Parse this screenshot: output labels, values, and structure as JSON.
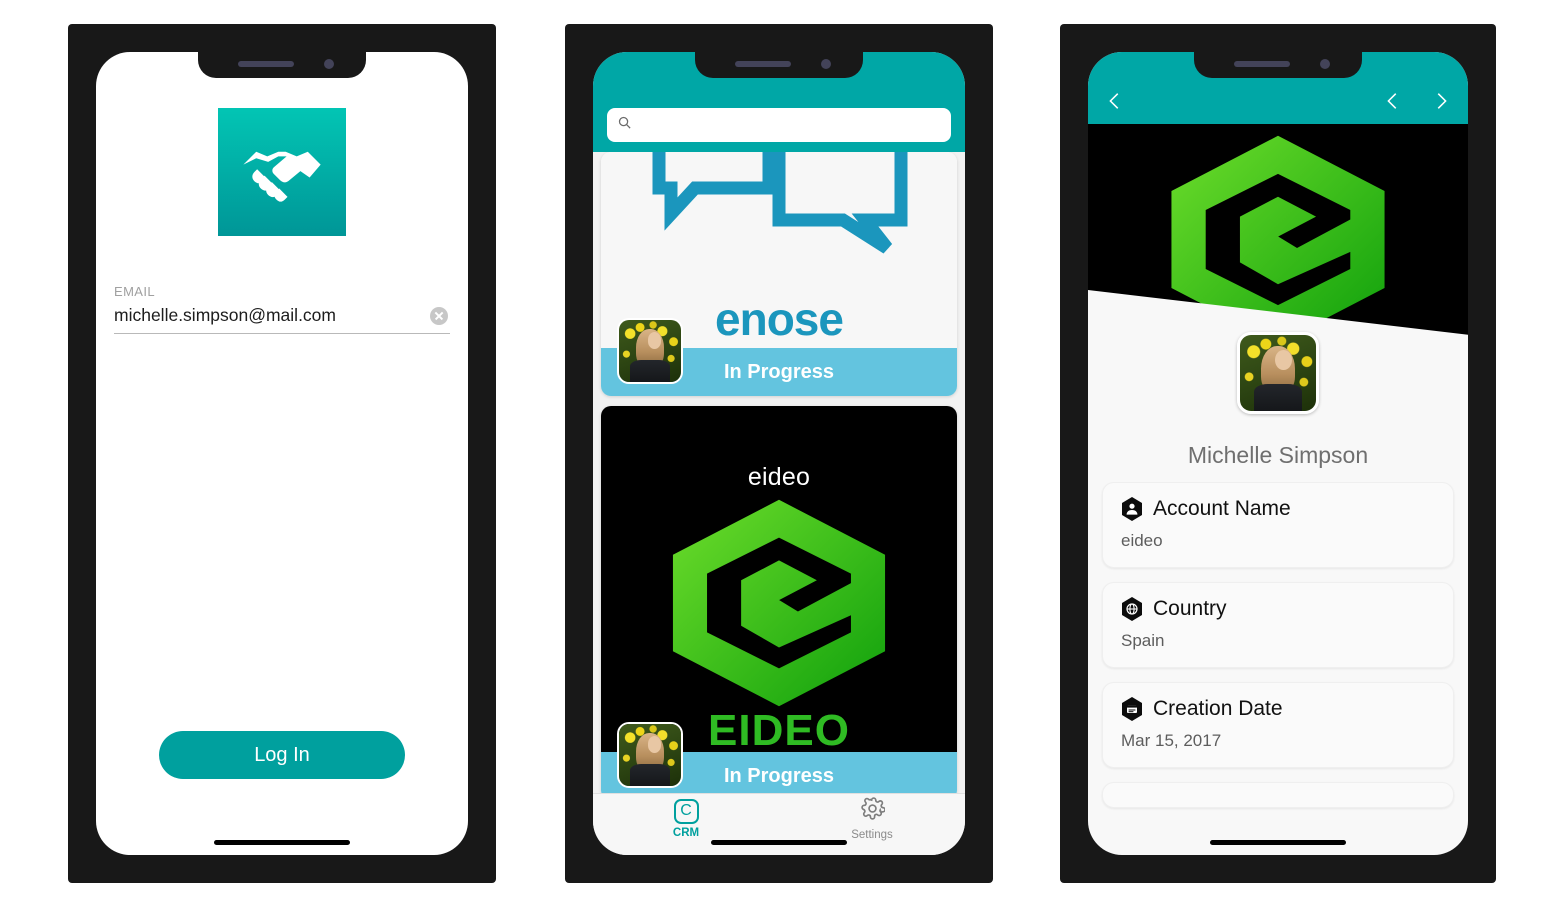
{
  "app": {
    "name": "CRM",
    "accent_teal": "#00a7a6",
    "accent_teal_dark": "#00a09e",
    "status_blue": "#63c4df",
    "logo_green": "#2fbb23",
    "bubble_blue": "#1b96bd"
  },
  "login_screen": {
    "logo_icon": "handshake-icon",
    "email_label": "EMAIL",
    "email_value": "michelle.simpson@mail.com",
    "email_placeholder": "Email",
    "clear_icon": "clear-circle-icon",
    "login_button": "Log In"
  },
  "list_screen": {
    "search": {
      "icon": "search-icon",
      "value": "",
      "placeholder": ""
    },
    "cards": [
      {
        "account_name": "enose",
        "logo_icon": "speech-bubbles-icon",
        "logo_style": "light",
        "status": "In Progress",
        "avatar_icon": "user-avatar"
      },
      {
        "account_name": "eideo",
        "wordmark": "EIDEO",
        "logo_icon": "hexagon-e-icon",
        "logo_style": "dark",
        "status": "In Progress",
        "avatar_icon": "user-avatar"
      }
    ],
    "tabs": [
      {
        "label": "CRM",
        "icon": "crm-icon",
        "glyph": "C",
        "active": true
      },
      {
        "label": "Settings",
        "icon": "gear-icon",
        "glyph": "",
        "active": false
      }
    ]
  },
  "detail_screen": {
    "nav": {
      "back_icon": "chevron-left-icon",
      "prev_icon": "chevron-left-icon",
      "next_icon": "chevron-right-icon"
    },
    "hero_logo_icon": "hexagon-e-icon",
    "avatar_icon": "user-avatar",
    "owner_name": "Michelle Simpson",
    "fields": [
      {
        "icon": "hexagon-person-icon",
        "label": "Account Name",
        "value": "eideo"
      },
      {
        "icon": "hexagon-globe-icon",
        "label": "Country",
        "value": "Spain"
      },
      {
        "icon": "hexagon-calendar-icon",
        "label": "Creation Date",
        "value": "Mar 15, 2017"
      }
    ]
  }
}
